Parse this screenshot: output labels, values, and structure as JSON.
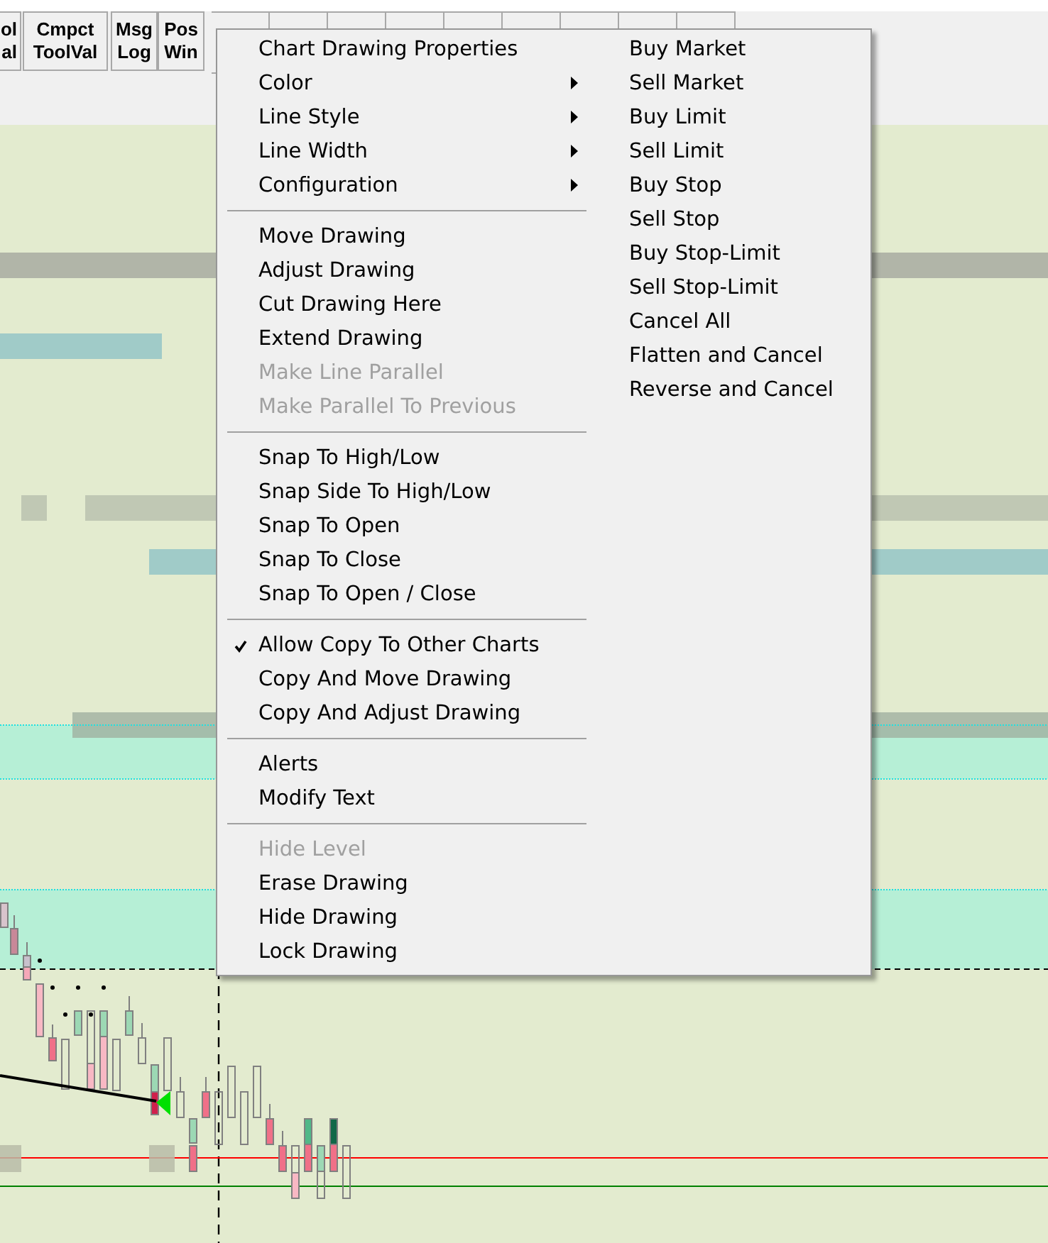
{
  "toolbar": {
    "buttons": [
      {
        "lines": [
          "ol",
          "al"
        ]
      },
      {
        "lines": [
          "Cmpct",
          "ToolVal"
        ]
      },
      {
        "lines": [
          "Msg",
          "Log"
        ]
      },
      {
        "lines": [
          "Pos",
          "Win"
        ]
      }
    ]
  },
  "context_menu": {
    "left_items": [
      {
        "kind": "item",
        "label": "Chart Drawing Properties",
        "disabled": false,
        "checked": false,
        "submenu": false
      },
      {
        "kind": "item",
        "label": "Color",
        "disabled": false,
        "checked": false,
        "submenu": true
      },
      {
        "kind": "item",
        "label": "Line Style",
        "disabled": false,
        "checked": false,
        "submenu": true
      },
      {
        "kind": "item",
        "label": "Line Width",
        "disabled": false,
        "checked": false,
        "submenu": true
      },
      {
        "kind": "item",
        "label": "Configuration",
        "disabled": false,
        "checked": false,
        "submenu": true
      },
      {
        "kind": "separator"
      },
      {
        "kind": "item",
        "label": "Move Drawing",
        "disabled": false,
        "checked": false,
        "submenu": false
      },
      {
        "kind": "item",
        "label": "Adjust Drawing",
        "disabled": false,
        "checked": false,
        "submenu": false
      },
      {
        "kind": "item",
        "label": "Cut Drawing Here",
        "disabled": false,
        "checked": false,
        "submenu": false
      },
      {
        "kind": "item",
        "label": "Extend Drawing",
        "disabled": false,
        "checked": false,
        "submenu": false
      },
      {
        "kind": "item",
        "label": "Make Line Parallel",
        "disabled": true,
        "checked": false,
        "submenu": false
      },
      {
        "kind": "item",
        "label": "Make Parallel To Previous",
        "disabled": true,
        "checked": false,
        "submenu": false
      },
      {
        "kind": "separator"
      },
      {
        "kind": "item",
        "label": "Snap To High/Low",
        "disabled": false,
        "checked": false,
        "submenu": false
      },
      {
        "kind": "item",
        "label": "Snap Side To High/Low",
        "disabled": false,
        "checked": false,
        "submenu": false
      },
      {
        "kind": "item",
        "label": "Snap To Open",
        "disabled": false,
        "checked": false,
        "submenu": false
      },
      {
        "kind": "item",
        "label": "Snap To Close",
        "disabled": false,
        "checked": false,
        "submenu": false
      },
      {
        "kind": "item",
        "label": "Snap To Open / Close",
        "disabled": false,
        "checked": false,
        "submenu": false
      },
      {
        "kind": "separator"
      },
      {
        "kind": "item",
        "label": "Allow Copy To Other Charts",
        "disabled": false,
        "checked": true,
        "submenu": false
      },
      {
        "kind": "item",
        "label": "Copy And Move Drawing",
        "disabled": false,
        "checked": false,
        "submenu": false
      },
      {
        "kind": "item",
        "label": "Copy And Adjust Drawing",
        "disabled": false,
        "checked": false,
        "submenu": false
      },
      {
        "kind": "separator"
      },
      {
        "kind": "item",
        "label": "Alerts",
        "disabled": false,
        "checked": false,
        "submenu": false
      },
      {
        "kind": "item",
        "label": "Modify Text",
        "disabled": false,
        "checked": false,
        "submenu": false
      },
      {
        "kind": "separator"
      },
      {
        "kind": "item",
        "label": "Hide Level",
        "disabled": true,
        "checked": false,
        "submenu": false
      },
      {
        "kind": "item",
        "label": "Erase Drawing",
        "disabled": false,
        "checked": false,
        "submenu": false
      },
      {
        "kind": "item",
        "label": "Hide Drawing",
        "disabled": false,
        "checked": false,
        "submenu": false
      },
      {
        "kind": "item",
        "label": "Lock Drawing",
        "disabled": false,
        "checked": false,
        "submenu": false
      }
    ],
    "right_items": [
      {
        "label": "Buy Market"
      },
      {
        "label": "Sell Market"
      },
      {
        "label": "Buy Limit"
      },
      {
        "label": "Sell Limit"
      },
      {
        "label": "Buy Stop"
      },
      {
        "label": "Sell Stop"
      },
      {
        "label": "Buy Stop-Limit"
      },
      {
        "label": "Sell Stop-Limit"
      },
      {
        "label": "Cancel All"
      },
      {
        "label": "Flatten and Cancel"
      },
      {
        "label": "Reverse and Cancel"
      }
    ]
  }
}
